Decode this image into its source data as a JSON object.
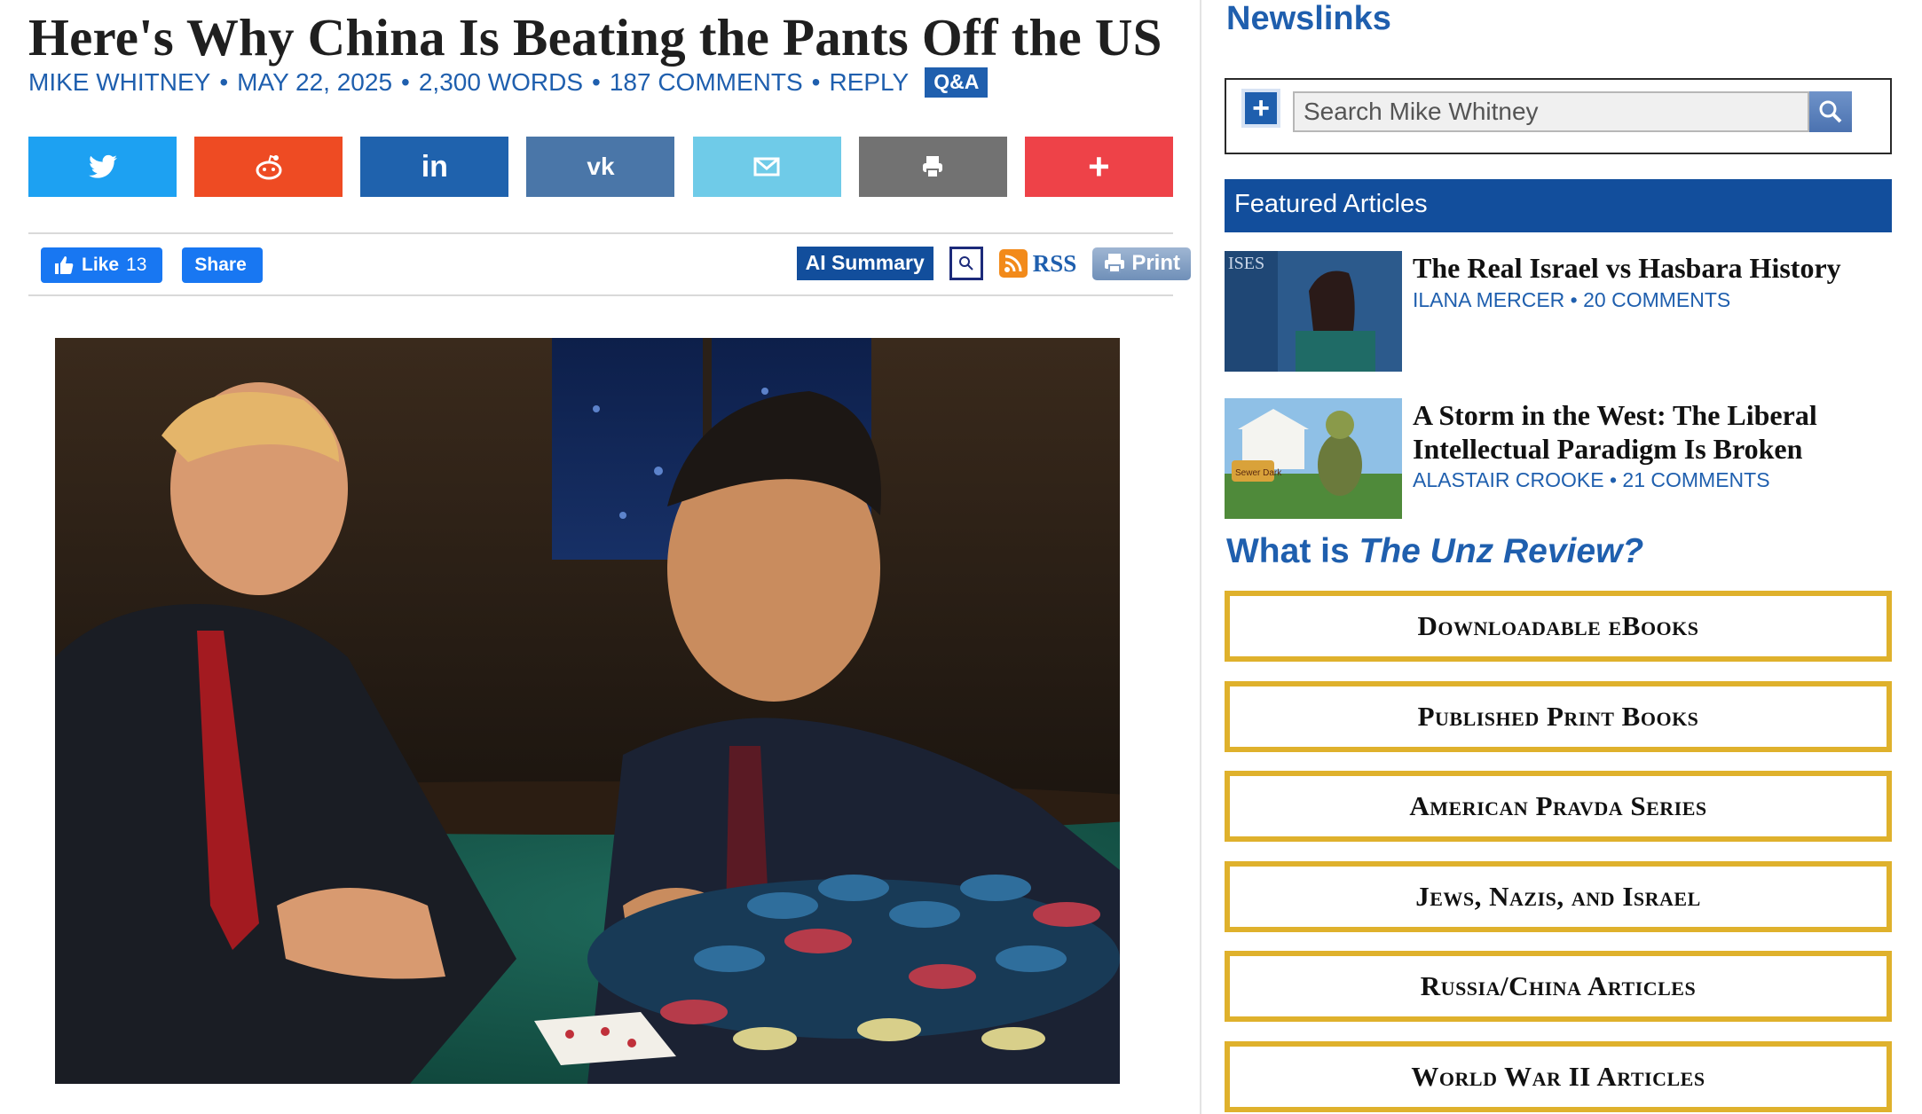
{
  "article": {
    "title": "Here's Why China Is Beating the Pants Off the US",
    "author": "MIKE WHITNEY",
    "date": "MAY 22, 2025",
    "words": "2,300 WORDS",
    "comments": "187 COMMENTS",
    "reply": "REPLY",
    "qa": "Q&A",
    "sep": "•"
  },
  "share_buttons": [
    {
      "name": "twitter",
      "icon": "twitter-icon",
      "color": "#1da1f2"
    },
    {
      "name": "reddit",
      "icon": "reddit-icon",
      "color": "#ee4b23"
    },
    {
      "name": "linkedin",
      "icon": "linkedin-icon",
      "color": "#1f62ad"
    },
    {
      "name": "vk",
      "icon": "vk-icon",
      "color": "#4a76a8"
    },
    {
      "name": "email",
      "icon": "mail-icon",
      "color": "#6fcbe8"
    },
    {
      "name": "print",
      "icon": "printer-icon",
      "color": "#727272"
    },
    {
      "name": "more",
      "icon": "plus-icon",
      "color": "#ee4248"
    }
  ],
  "social": {
    "like_label": "Like",
    "like_count": "13",
    "share_label": "Share"
  },
  "tools": {
    "ai_summary": "AI Summary",
    "rss": "RSS",
    "print": "Print"
  },
  "sidebar": {
    "newslinks": "Newslinks",
    "search_placeholder": "Search Mike Whitney",
    "featured_heading": "Featured Articles",
    "featured": [
      {
        "title": "The Real Israel vs Hasbara History",
        "author": "ILANA MERCER",
        "comments": "20 COMMENTS"
      },
      {
        "title": "A Storm in the West: The Liberal Intellectual Paradigm Is Broken",
        "author": "ALASTAIR CROOKE",
        "comments": "21 COMMENTS"
      }
    ],
    "what_is_prefix": "What is ",
    "what_is_name": "The Unz Review?",
    "gold_buttons": [
      "Downloadable eBooks",
      "Published Print Books",
      "American Pravda Series",
      "Jews, Nazis, and Israel",
      "Russia/China Articles",
      "World War II Articles"
    ],
    "thumb1_text": "ISES",
    "thumb2_sign": "Sewer Dark"
  },
  "colors": {
    "link_blue": "#1f5fae",
    "header_blue": "#124e9c",
    "gold": "#dfb12c"
  }
}
